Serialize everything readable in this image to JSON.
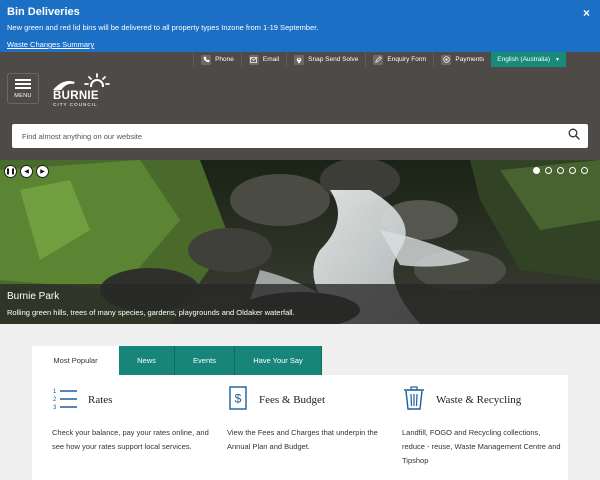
{
  "alert": {
    "title": "Bin Deliveries",
    "text": "New green and red lid bins will be delivered to all property types Inzone from 1-19 September.",
    "link": "Waste Changes Summary",
    "close": "×"
  },
  "utility": {
    "items": [
      {
        "label": "Phone",
        "icon": "phone-icon"
      },
      {
        "label": "Email",
        "icon": "email-icon"
      },
      {
        "label": "Snap Send Solve",
        "icon": "location-pin-icon"
      },
      {
        "label": "Enquiry Form",
        "icon": "pencil-icon"
      },
      {
        "label": "Payments",
        "icon": "coins-icon"
      }
    ],
    "language": "English (Australia)"
  },
  "header": {
    "menu_label": "MENU",
    "logo_name": "BURNIE",
    "logo_sub": "CITY COUNCIL"
  },
  "search": {
    "placeholder": "Find almost anything on our website"
  },
  "hero": {
    "title": "Burnie Park",
    "text": "Rolling green hills, trees of many species, gardens, playgrounds and Oldaker waterfall.",
    "dots": 5,
    "active_dot": 0
  },
  "tabs": [
    {
      "label": "Most Popular",
      "active": true
    },
    {
      "label": "News",
      "active": false
    },
    {
      "label": "Events",
      "active": false
    },
    {
      "label": "Have Your Say",
      "active": false
    }
  ],
  "popular": [
    {
      "title": "Rates",
      "icon": "numbered-list-icon",
      "text": "Check your balance, pay your rates online, and see how your rates support local services."
    },
    {
      "title": "Fees & Budget",
      "icon": "dollar-document-icon",
      "text": "View the Fees and Charges that underpin the Annual Plan and Budget."
    },
    {
      "title": "Waste & Recycling",
      "icon": "bin-icon",
      "text": "Landfill, FOGO and Recycling collections, reduce - reuse, Waste Management Centre and Tipshop"
    }
  ],
  "colors": {
    "alert_blue": "#1b6fc4",
    "header_grey": "#4d4a47",
    "teal": "#17857a",
    "icon_blue": "#1d5f9e"
  }
}
